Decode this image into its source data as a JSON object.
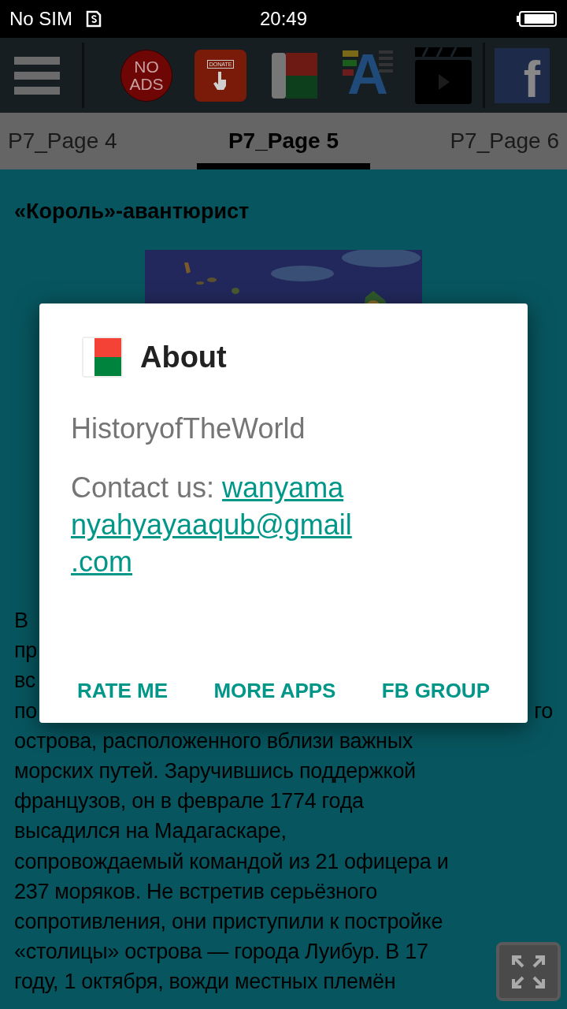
{
  "status_bar": {
    "carrier": "No SIM",
    "time": "20:49"
  },
  "toolbar": {
    "no_ads": [
      "NO",
      "ADS"
    ],
    "donate": "DONATE",
    "font_letter": "A",
    "facebook_letter": "f"
  },
  "tabs": [
    {
      "label": "P7_Page 4",
      "selected": false
    },
    {
      "label": "P7_Page 5",
      "selected": true
    },
    {
      "label": "P7_Page 6",
      "selected": false
    }
  ],
  "article": {
    "title": "«Король»-авантюрист",
    "lines": [
      {
        "left": "В"
      },
      {
        "left": "пр"
      },
      {
        "left": "вс"
      },
      {
        "left": "по",
        "right": "го"
      },
      {
        "left": "острова, расположенного вблизи важных"
      },
      {
        "left": "морских путей. Заручившись поддержкой"
      },
      {
        "left": "французов, он в феврале 1774 года"
      },
      {
        "left": "высадился на Мадагаскаре,"
      },
      {
        "left": "сопровождаемый командой из 21 офицера и"
      },
      {
        "left": "237 моряков. Не встретив серьёзного"
      },
      {
        "left": "сопротивления, они приступили к постройке"
      },
      {
        "left": "«столицы» острова — города Луибур. В 17"
      },
      {
        "left": "году, 1 октября, вожди местных племён"
      }
    ]
  },
  "dialog": {
    "title": "About",
    "app_name": "HistoryofTheWorld",
    "contact_label": "Contact us: ",
    "email_lines": [
      "wanyama",
      "nyahyayaaqub@gmail",
      ".com"
    ],
    "buttons": [
      "RATE ME",
      "MORE APPS",
      "FB GROUP"
    ]
  }
}
